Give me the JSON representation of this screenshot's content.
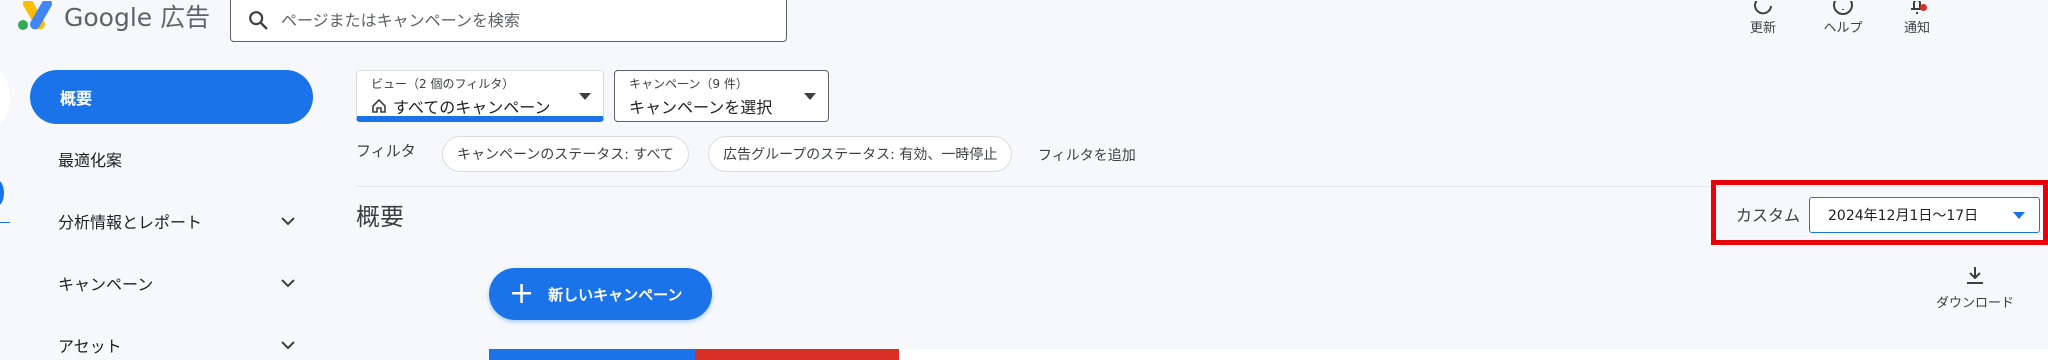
{
  "header": {
    "logo_text": "Google 広告",
    "search_placeholder": "ページまたはキャンペーンを検索",
    "actions": [
      {
        "label": "更新",
        "icon": "refresh-icon"
      },
      {
        "label": "ヘルプ",
        "icon": "help-icon"
      },
      {
        "label": "通知",
        "icon": "bell-icon"
      }
    ]
  },
  "sidebar": {
    "items": [
      {
        "label": "概要",
        "active": true
      },
      {
        "label": "最適化案",
        "expandable": false
      },
      {
        "label": "分析情報とレポート",
        "expandable": true
      },
      {
        "label": "キャンペーン",
        "expandable": true
      },
      {
        "label": "アセット",
        "expandable": true
      }
    ]
  },
  "filters": {
    "view": {
      "caption": "ビュー（2 個のフィルタ）",
      "value": "すべてのキャンペーン"
    },
    "campaign": {
      "caption": "キャンペーン（9 件）",
      "value": "キャンペーンを選択"
    },
    "label": "フィルタ",
    "chips": [
      "キャンペーンのステータス: すべて",
      "広告グループのステータス: 有効、一時停止"
    ],
    "add_filter": "フィルタを追加"
  },
  "main": {
    "title": "概要",
    "date_range": {
      "label": "カスタム",
      "value": "2024年12月1日～17日"
    },
    "new_campaign_label": "新しいキャンペーン",
    "download_label": "ダウンロード"
  },
  "colors": {
    "accent": "#1a73e8",
    "highlight": "#e8000b",
    "red_bar": "#d93025"
  }
}
